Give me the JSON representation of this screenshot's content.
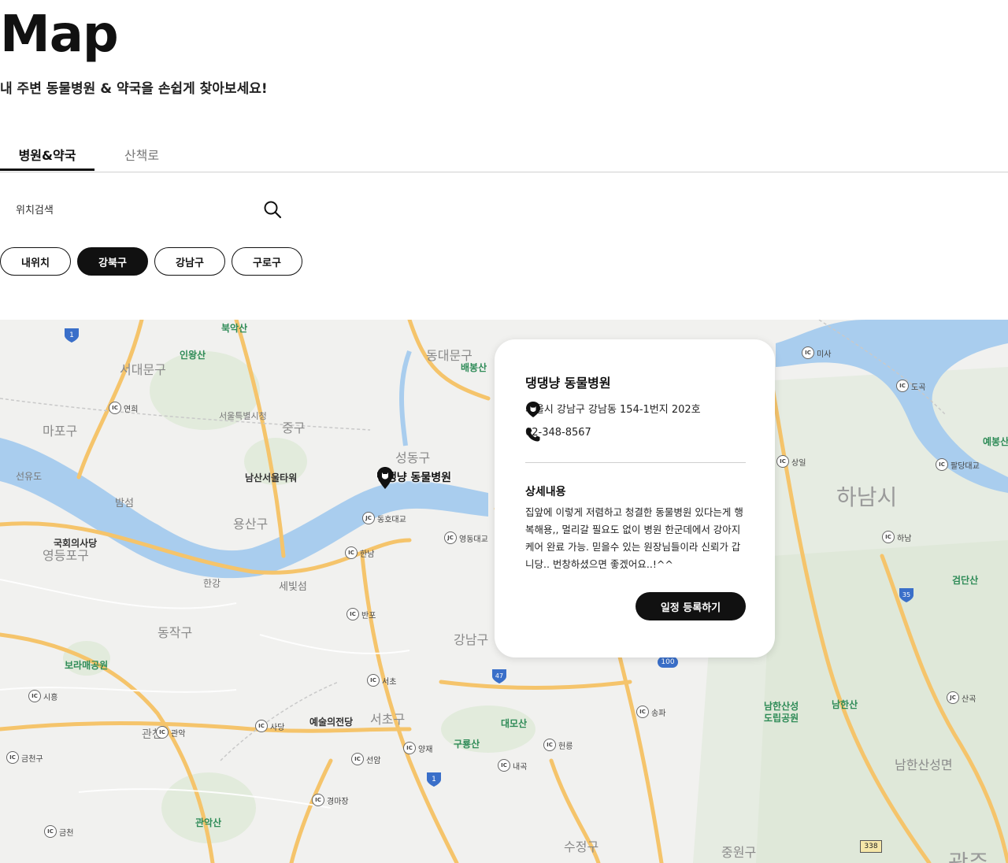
{
  "header": {
    "title": "Map",
    "subtitle": "내 주변 동물병원 & 약국을 손쉽게 찾아보세요!"
  },
  "tabs": [
    {
      "label": "병원&약국",
      "active": true
    },
    {
      "label": "산책로",
      "active": false
    }
  ],
  "search": {
    "placeholder": "위치검색",
    "icon": "search-icon"
  },
  "filters": [
    {
      "label": "내위치",
      "selected": false
    },
    {
      "label": "강북구",
      "selected": true
    },
    {
      "label": "강남구",
      "selected": false
    },
    {
      "label": "구로구",
      "selected": false
    }
  ],
  "map": {
    "marker_label": "댕댕냥 동물병원",
    "places": {
      "bukaksan": "북악산",
      "inwangsan": "인왕산",
      "seodaemun": "서대문구",
      "dongdaemun": "동대문구",
      "baebongsan": "배봉산",
      "yeonhui": "연희",
      "mapo": "마포구",
      "seoulcity": "서울특별시청",
      "junggu": "중구",
      "seongdong": "성동구",
      "seonyudo": "선유도",
      "namsan": "남산서울타워",
      "bamseom": "밤섬",
      "yongsan": "용산구",
      "dongho": "동호대교",
      "yeongdong": "영동대교",
      "assembly": "국회의사당",
      "yeongdeungpo": "영등포구",
      "hannam": "한남",
      "hangang": "한강",
      "sebit": "세빛섬",
      "banpo": "반포",
      "dongjak": "동작구",
      "gangnam": "강남구",
      "boramae": "보라매공원",
      "seocho_ic": "서초",
      "siheung": "시흥",
      "gwanak_ic": "관악",
      "sadang": "사당",
      "arts": "예술의전당",
      "seocho": "서초구",
      "daemosan": "대모산",
      "guryongsan": "구룡산",
      "yangjae": "양재",
      "heolleung": "헌릉",
      "gwancheon": "관천",
      "geumcheon_gu": "금천구",
      "seonam": "선암",
      "naegok": "내곡",
      "songpa": "송파",
      "gyeongmajang": "경마장",
      "gwanaksan": "관악산",
      "geumcheon": "금천",
      "sujeong": "수정구",
      "jungwon": "중원구",
      "misa": "미사",
      "dogok": "도곡",
      "yebongsan": "예봉산",
      "sangil": "상일",
      "paldang": "팔당대교",
      "hanam_city": "하남시",
      "hanam_ic": "하남",
      "geomdansan": "검단산",
      "namhansanseong_park": "남한산성\n도립공원",
      "namhansan": "남한산",
      "sangok": "산곡",
      "namhansanseong_myeon": "남한산성면",
      "gwangju": "광주"
    },
    "route_numbers": [
      "1",
      "47",
      "100",
      "35",
      "1",
      "338"
    ]
  },
  "info_card": {
    "name": "댕댕냥 동물병원",
    "address": "서울시 강남구 강남동 154-1번지 202호",
    "phone": "02-348-8567",
    "detail_title": "상세내용",
    "detail_text": "집앞에 이렇게 저렴하고 청결한 동물병원 있다는게 행복해용,, 멀리갈 필요도 없이 병원 한군데에서 강아지 케어 완료 가능. 믿을수 있는 원장님들이라 신뢰가 갑니당.. 번창하셨으면 좋겠어요..!^^",
    "button_label": "일정 등록하기"
  },
  "colors": {
    "accent": "#111111",
    "river": "#a9cdee",
    "road": "#f5c46b",
    "park": "#dfe9d8"
  }
}
